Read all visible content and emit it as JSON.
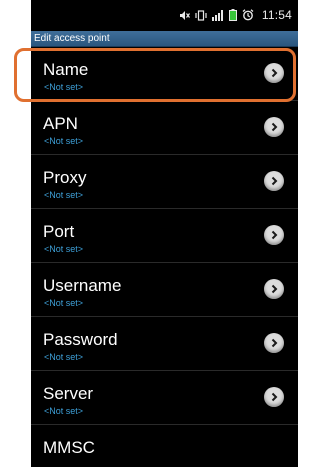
{
  "status_bar": {
    "time": "11:54",
    "icons": [
      "mute-icon",
      "vibrate-icon",
      "signal-icon",
      "battery-icon",
      "alarm-icon"
    ]
  },
  "screen": {
    "title": "Edit access point"
  },
  "rows": [
    {
      "label": "Name",
      "value": "<Not set>"
    },
    {
      "label": "APN",
      "value": "<Not set>"
    },
    {
      "label": "Proxy",
      "value": "<Not set>"
    },
    {
      "label": "Port",
      "value": "<Not set>"
    },
    {
      "label": "Username",
      "value": "<Not set>"
    },
    {
      "label": "Password",
      "value": "<Not set>"
    },
    {
      "label": "Server",
      "value": "<Not set>"
    },
    {
      "label": "MMSC",
      "value": ""
    }
  ],
  "colors": {
    "highlight": "#e07030",
    "value_text": "#3ea0d8",
    "title_bar": "#2f5f8a"
  }
}
